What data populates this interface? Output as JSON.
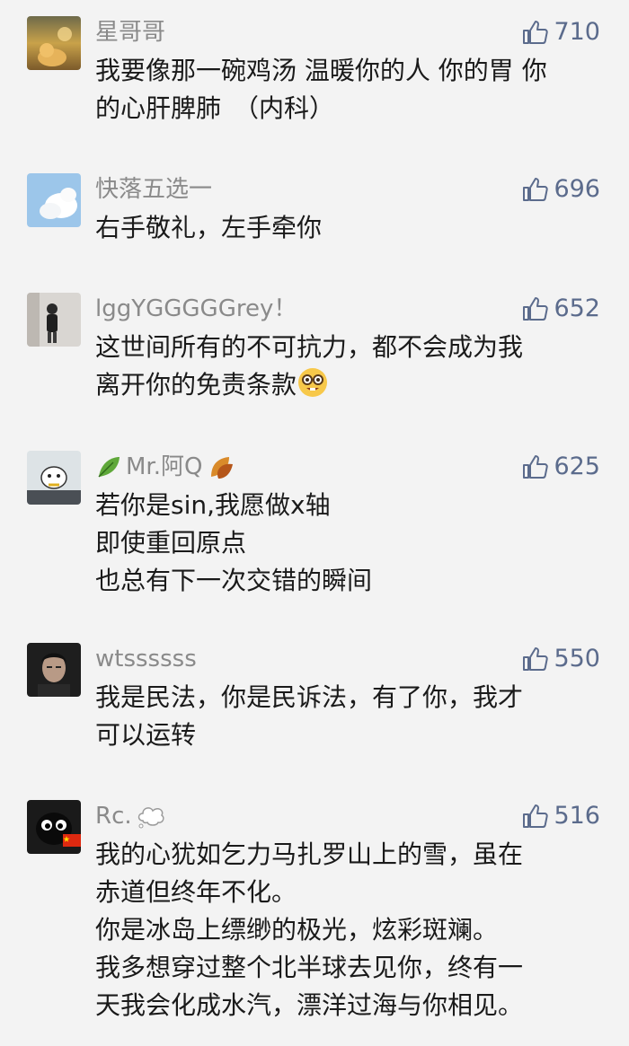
{
  "comments": [
    {
      "username": "星哥哥",
      "likes": "710",
      "lines": [
        "我要像那一碗鸡汤 温暖你的人 你的胃 你",
        "的心肝脾肺　（内科）"
      ],
      "avatar_icon": "cat-sunset-avatar"
    },
    {
      "username": "快落五选一",
      "likes": "696",
      "lines": [
        "右手敬礼，左手牵你"
      ],
      "avatar_icon": "sky-cloud-avatar"
    },
    {
      "username": "lggYGGGGGrey！",
      "likes": "652",
      "lines": [
        "这世间所有的不可抗力，都不会成为我",
        "离开你的免责条款"
      ],
      "avatar_icon": "person-photo-avatar",
      "trailing_emoji": "nerd-face-emoji"
    },
    {
      "username": "Mr.阿Q",
      "likes": "625",
      "lines": [
        "若你是sin,我愿做x轴",
        "即使重回原点",
        "也总有下一次交错的瞬间"
      ],
      "avatar_icon": "cartoon-sheep-avatar",
      "leading_emoji": "leaf-emoji",
      "trailing_emoji": "fallen-leaf-emoji"
    },
    {
      "username": "wtssssss",
      "likes": "550",
      "lines": [
        "我是民法，你是民诉法，有了你，我才",
        "可以运转"
      ],
      "avatar_icon": "man-portrait-avatar"
    },
    {
      "username": "Rc.",
      "likes": "516",
      "lines": [
        "我的心犹如乞力马扎罗山上的雪，虽在",
        "赤道但终年不化。",
        "你是冰岛上缥缈的极光，炫彩斑斓。",
        "我多想穿过整个北半球去见你，终有一",
        "天我会化成水汽，漂洋过海与你相见。"
      ],
      "avatar_icon": "black-cat-avatar",
      "trailing_emoji": "thought-bubble-emoji",
      "flag_icon": "china-flag-icon"
    }
  ],
  "colors": {
    "background": "#f3f3f3",
    "username": "#8a8a8a",
    "like": "#5b6b8c",
    "text": "#1a1a1a"
  }
}
